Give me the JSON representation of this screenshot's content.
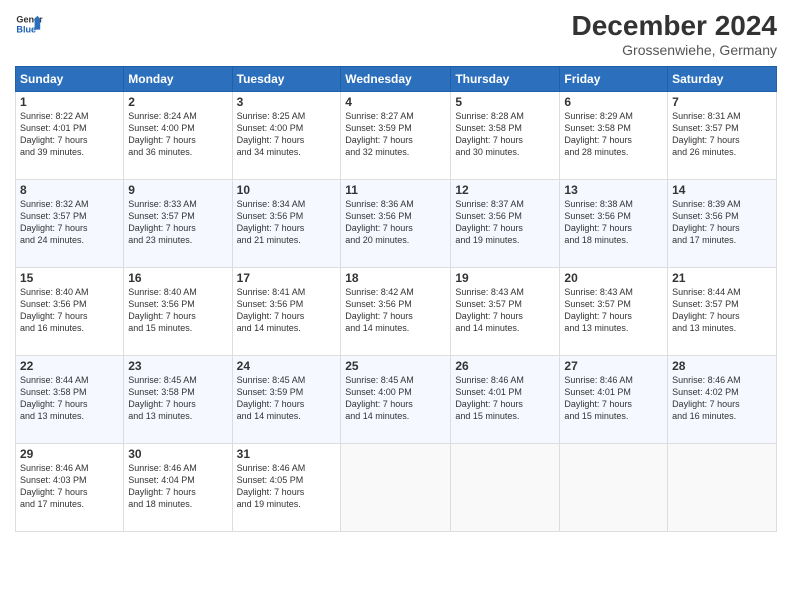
{
  "logo": {
    "line1": "General",
    "line2": "Blue"
  },
  "title": "December 2024",
  "location": "Grossenwiehe, Germany",
  "days_of_week": [
    "Sunday",
    "Monday",
    "Tuesday",
    "Wednesday",
    "Thursday",
    "Friday",
    "Saturday"
  ],
  "weeks": [
    [
      {
        "day": "1",
        "sunrise": "8:22 AM",
        "sunset": "4:01 PM",
        "daylight_h": 7,
        "daylight_m": 39
      },
      {
        "day": "2",
        "sunrise": "8:24 AM",
        "sunset": "4:00 PM",
        "daylight_h": 7,
        "daylight_m": 36
      },
      {
        "day": "3",
        "sunrise": "8:25 AM",
        "sunset": "4:00 PM",
        "daylight_h": 7,
        "daylight_m": 34
      },
      {
        "day": "4",
        "sunrise": "8:27 AM",
        "sunset": "3:59 PM",
        "daylight_h": 7,
        "daylight_m": 32
      },
      {
        "day": "5",
        "sunrise": "8:28 AM",
        "sunset": "3:58 PM",
        "daylight_h": 7,
        "daylight_m": 30
      },
      {
        "day": "6",
        "sunrise": "8:29 AM",
        "sunset": "3:58 PM",
        "daylight_h": 7,
        "daylight_m": 28
      },
      {
        "day": "7",
        "sunrise": "8:31 AM",
        "sunset": "3:57 PM",
        "daylight_h": 7,
        "daylight_m": 26
      }
    ],
    [
      {
        "day": "8",
        "sunrise": "8:32 AM",
        "sunset": "3:57 PM",
        "daylight_h": 7,
        "daylight_m": 24
      },
      {
        "day": "9",
        "sunrise": "8:33 AM",
        "sunset": "3:57 PM",
        "daylight_h": 7,
        "daylight_m": 23
      },
      {
        "day": "10",
        "sunrise": "8:34 AM",
        "sunset": "3:56 PM",
        "daylight_h": 7,
        "daylight_m": 21
      },
      {
        "day": "11",
        "sunrise": "8:36 AM",
        "sunset": "3:56 PM",
        "daylight_h": 7,
        "daylight_m": 20
      },
      {
        "day": "12",
        "sunrise": "8:37 AM",
        "sunset": "3:56 PM",
        "daylight_h": 7,
        "daylight_m": 19
      },
      {
        "day": "13",
        "sunrise": "8:38 AM",
        "sunset": "3:56 PM",
        "daylight_h": 7,
        "daylight_m": 18
      },
      {
        "day": "14",
        "sunrise": "8:39 AM",
        "sunset": "3:56 PM",
        "daylight_h": 7,
        "daylight_m": 17
      }
    ],
    [
      {
        "day": "15",
        "sunrise": "8:40 AM",
        "sunset": "3:56 PM",
        "daylight_h": 7,
        "daylight_m": 16
      },
      {
        "day": "16",
        "sunrise": "8:40 AM",
        "sunset": "3:56 PM",
        "daylight_h": 7,
        "daylight_m": 15
      },
      {
        "day": "17",
        "sunrise": "8:41 AM",
        "sunset": "3:56 PM",
        "daylight_h": 7,
        "daylight_m": 14
      },
      {
        "day": "18",
        "sunrise": "8:42 AM",
        "sunset": "3:56 PM",
        "daylight_h": 7,
        "daylight_m": 14
      },
      {
        "day": "19",
        "sunrise": "8:43 AM",
        "sunset": "3:57 PM",
        "daylight_h": 7,
        "daylight_m": 14
      },
      {
        "day": "20",
        "sunrise": "8:43 AM",
        "sunset": "3:57 PM",
        "daylight_h": 7,
        "daylight_m": 13
      },
      {
        "day": "21",
        "sunrise": "8:44 AM",
        "sunset": "3:57 PM",
        "daylight_h": 7,
        "daylight_m": 13
      }
    ],
    [
      {
        "day": "22",
        "sunrise": "8:44 AM",
        "sunset": "3:58 PM",
        "daylight_h": 7,
        "daylight_m": 13
      },
      {
        "day": "23",
        "sunrise": "8:45 AM",
        "sunset": "3:58 PM",
        "daylight_h": 7,
        "daylight_m": 13
      },
      {
        "day": "24",
        "sunrise": "8:45 AM",
        "sunset": "3:59 PM",
        "daylight_h": 7,
        "daylight_m": 14
      },
      {
        "day": "25",
        "sunrise": "8:45 AM",
        "sunset": "4:00 PM",
        "daylight_h": 7,
        "daylight_m": 14
      },
      {
        "day": "26",
        "sunrise": "8:46 AM",
        "sunset": "4:01 PM",
        "daylight_h": 7,
        "daylight_m": 15
      },
      {
        "day": "27",
        "sunrise": "8:46 AM",
        "sunset": "4:01 PM",
        "daylight_h": 7,
        "daylight_m": 15
      },
      {
        "day": "28",
        "sunrise": "8:46 AM",
        "sunset": "4:02 PM",
        "daylight_h": 7,
        "daylight_m": 16
      }
    ],
    [
      {
        "day": "29",
        "sunrise": "8:46 AM",
        "sunset": "4:03 PM",
        "daylight_h": 7,
        "daylight_m": 17
      },
      {
        "day": "30",
        "sunrise": "8:46 AM",
        "sunset": "4:04 PM",
        "daylight_h": 7,
        "daylight_m": 18
      },
      {
        "day": "31",
        "sunrise": "8:46 AM",
        "sunset": "4:05 PM",
        "daylight_h": 7,
        "daylight_m": 19
      },
      null,
      null,
      null,
      null
    ]
  ],
  "labels": {
    "sunrise": "Sunrise:",
    "sunset": "Sunset:",
    "daylight": "Daylight: "
  }
}
